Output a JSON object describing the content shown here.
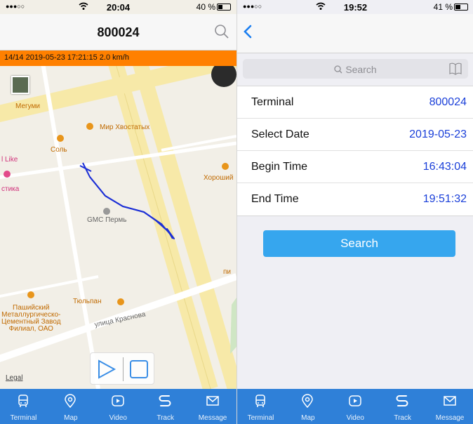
{
  "left": {
    "status": {
      "signal": "●●●○○",
      "time": "20:04",
      "battery": "40 %",
      "battery_level": 0.4
    },
    "nav": {
      "title": "800024"
    },
    "info": {
      "text": "14/14   2019-05-23 17:21:15  2.0 km/h"
    },
    "map": {
      "pois": {
        "megumi": "Мегуми",
        "mir": "Мир Хвостатых",
        "sol": "Соль",
        "like": "l Like",
        "stika": "стика",
        "horoshiy": "Хороший",
        "gmc": "GMC Пермь",
        "tyulpan": "Тюльпан",
        "pashiysky": "Пашийский\nМеталлургическо-\nЦементный Завод\nФилиал, ОАО",
        "ulitsa": "улица Краснова",
        "pi": "пи"
      },
      "legal": "Legal"
    }
  },
  "right": {
    "status": {
      "signal": "●●●○○",
      "time": "19:52",
      "battery": "41 %",
      "battery_level": 0.41
    },
    "search_placeholder": "Search",
    "rows": [
      {
        "label": "Terminal",
        "value": "800024"
      },
      {
        "label": "Select Date",
        "value": "2019-05-23"
      },
      {
        "label": "Begin Time",
        "value": "16:43:04"
      },
      {
        "label": "End Time",
        "value": "19:51:32"
      }
    ],
    "search_button": "Search"
  },
  "tabs": [
    {
      "label": "Terminal",
      "icon": "bus-icon"
    },
    {
      "label": "Map",
      "icon": "map-pin-icon"
    },
    {
      "label": "Video",
      "icon": "play-icon"
    },
    {
      "label": "Track",
      "icon": "track-icon"
    },
    {
      "label": "Message",
      "icon": "envelope-icon"
    }
  ],
  "colors": {
    "accent": "#2f80d8",
    "infobar": "#ff8000",
    "value": "#1a3fd9",
    "button": "#36a6ee",
    "track": "#1c2fd6"
  }
}
